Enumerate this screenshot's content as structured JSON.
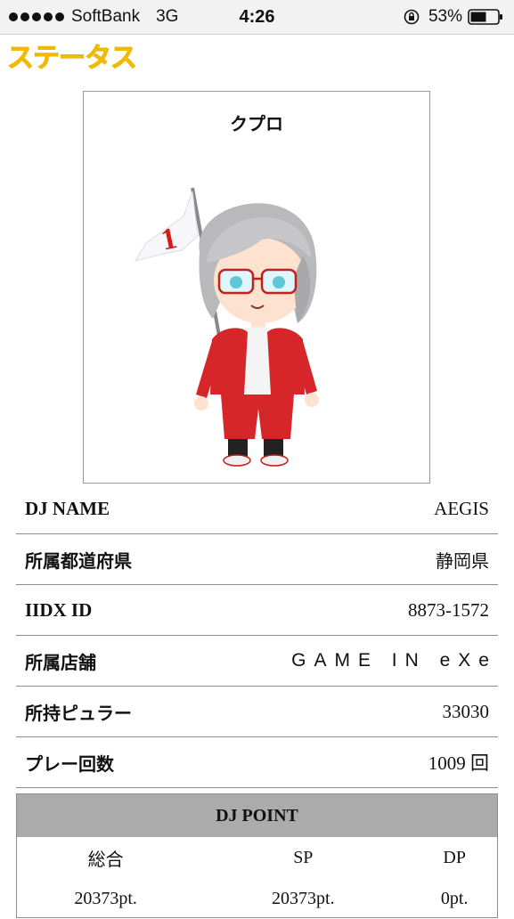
{
  "status_bar": {
    "carrier": "SoftBank",
    "network": "3G",
    "time": "4:26",
    "battery": "53%",
    "icons": [
      "signal-dots-icon",
      "orientation-lock-icon",
      "battery-icon"
    ]
  },
  "page": {
    "title": "ステータス",
    "title_color": "#f6c40a"
  },
  "avatar": {
    "name": "クプロ",
    "flag_number": "1"
  },
  "info": [
    {
      "label": "DJ NAME",
      "value": "AEGIS"
    },
    {
      "label": "所属都道府県",
      "value": "静岡県"
    },
    {
      "label": "IIDX ID",
      "value": "8873-1572"
    },
    {
      "label": "所属店舗",
      "value": "GAME IN eXe"
    },
    {
      "label": "所持ピュラー",
      "value": "33030"
    },
    {
      "label": "プレー回数",
      "value": "1009 回"
    }
  ],
  "dj_point": {
    "title": "DJ POINT",
    "columns": [
      "総合",
      "SP",
      "DP"
    ],
    "values": [
      "20373pt.",
      "20373pt.",
      "0pt."
    ]
  }
}
